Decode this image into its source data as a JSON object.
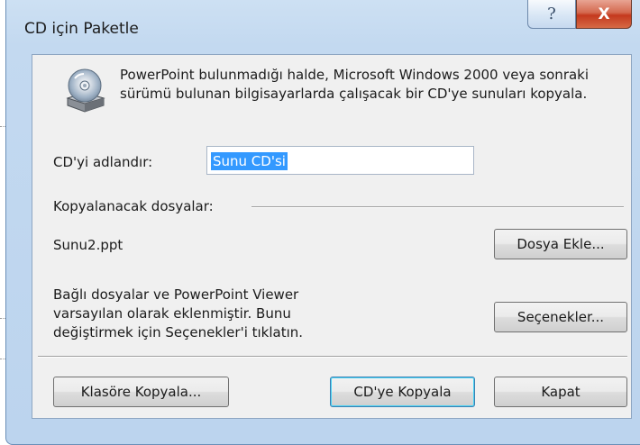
{
  "window": {
    "title": "CD için Paketle",
    "help_glyph": "?",
    "close_glyph": "X"
  },
  "description": "PowerPoint bulunmadığı halde, Microsoft Windows 2000 veya sonraki sürümü bulunan bilgisayarlarda çalışacak bir CD'ye sunuları kopyala.",
  "cd_name": {
    "label": "CD'yi adlandır:",
    "value": "Sunu CD'si"
  },
  "files": {
    "section_label": "Kopyalanacak dosyalar:",
    "items": [
      "Sunu2.ppt"
    ],
    "add_button": "Dosya Ekle..."
  },
  "linked_info": {
    "text": "Bağlı dosyalar ve PowerPoint Viewer varsayılan olarak eklenmiştir. Bunu değiştirmek için Seçenekler'i tıklatın.",
    "options_button": "Seçenekler..."
  },
  "footer": {
    "copy_to_folder": "Klasöre Kopyala...",
    "copy_to_cd": "CD'ye Kopyala",
    "close": "Kapat"
  },
  "icons": {
    "cd": "cd-drive-icon"
  }
}
